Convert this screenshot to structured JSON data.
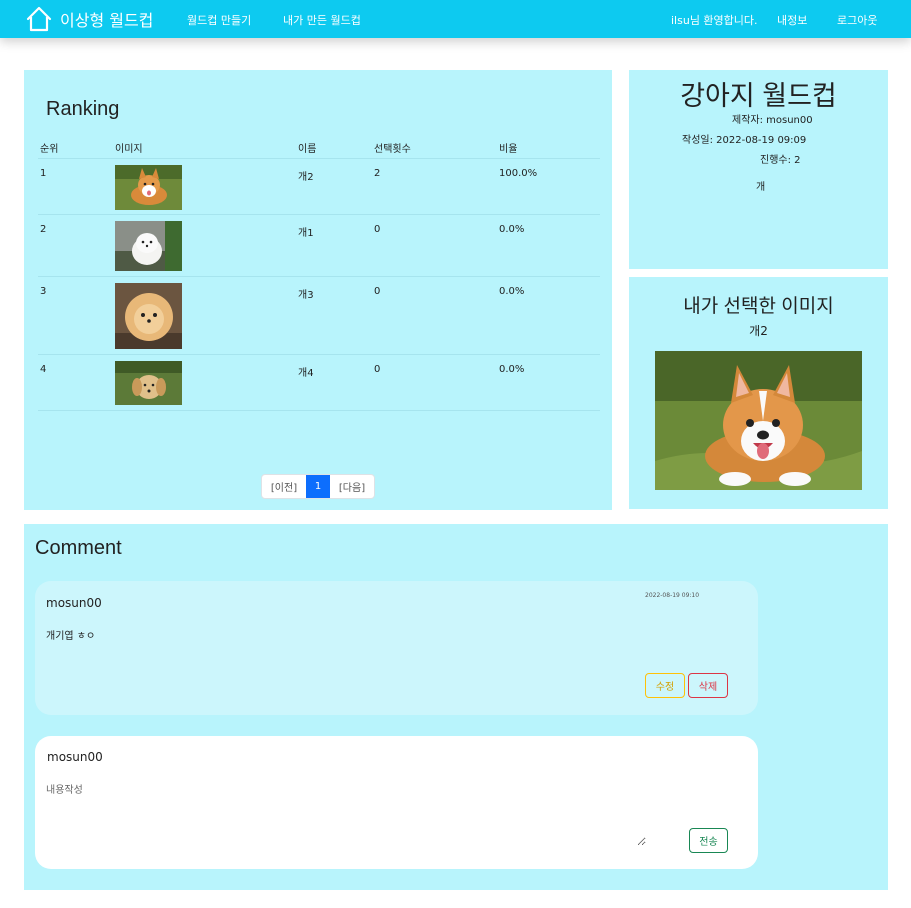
{
  "nav": {
    "brand": "이상형 월드컵",
    "links": [
      "월드컵 만들기",
      "내가 만든 월드컵"
    ],
    "welcome": "ilsu님 환영합니다.",
    "profile": "내정보",
    "logout": "로그아웃"
  },
  "ranking": {
    "title": "Ranking",
    "headers": [
      "순위",
      "이미지",
      "이름",
      "선택횟수",
      "비율"
    ],
    "rows": [
      {
        "rank": "1",
        "image": "corgi-photo",
        "name": "개2",
        "count": "2",
        "ratio": "100.0%"
      },
      {
        "rank": "2",
        "image": "white-pomeranian-photo",
        "name": "개1",
        "count": "0",
        "ratio": "0.0%"
      },
      {
        "rank": "3",
        "image": "fluffy-pomeranian-photo",
        "name": "개3",
        "count": "0",
        "ratio": "0.0%"
      },
      {
        "rank": "4",
        "image": "golden-retriever-puppy-photo",
        "name": "개4",
        "count": "0",
        "ratio": "0.0%"
      }
    ],
    "pagination": {
      "prev": "[이전]",
      "current": "1",
      "next": "[다음]"
    }
  },
  "info": {
    "title": "강아지 월드컵",
    "creator": "제작자: mosun00",
    "created": "작성일: 2022-08-19 09:09",
    "plays": "진행수: 2",
    "description": "개"
  },
  "selected": {
    "title": "내가 선택한 이미지",
    "name": "개2",
    "image": "corgi-photo"
  },
  "comments": {
    "title": "Comment",
    "items": [
      {
        "author": "mosun00",
        "date": "2022-08-19 09:10",
        "text": "개기엽 ㅎㅇ",
        "edit": "수정",
        "delete": "삭제"
      }
    ],
    "form": {
      "author": "mosun00",
      "placeholder": "내용작성",
      "submit": "전송"
    }
  },
  "colors": {
    "navbar": "#0dcaf0",
    "panel": "#b8f4fc",
    "card": "#ccf6fc",
    "primary": "#0d6efd"
  }
}
